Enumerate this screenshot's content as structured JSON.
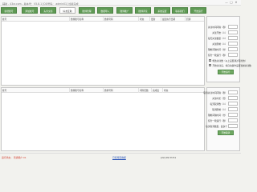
{
  "window": {
    "title": "辅助 - 43xr.com - 版本号：V5.8.1    [QQ号码：  admin01]  加载完成",
    "controls": [
      "—",
      "□",
      "✕"
    ]
  },
  "tabs": [
    {
      "label": "新增账号",
      "active": false
    },
    {
      "label": "添加帐号",
      "active": false
    },
    {
      "label": "头条交易",
      "active": false
    },
    {
      "label": "好友互助",
      "active": true
    },
    {
      "label": "微博管理",
      "active": false
    },
    {
      "label": "数据导入",
      "active": false
    },
    {
      "label": "微博推广",
      "active": false
    },
    {
      "label": "微博评论",
      "active": false
    },
    {
      "label": "系统设置",
      "active": false
    },
    {
      "label": "联系我们",
      "active": false
    },
    {
      "label": "开始运行",
      "active": false
    }
  ],
  "top_table": {
    "columns": [
      "账号",
      "微博账号名称",
      "微博号码",
      "状态",
      "更新",
      "最近执行日期",
      "回调"
    ]
  },
  "bottom_table": {
    "columns": [
      "账号",
      "微博账号名称",
      "微博号码",
      "间隔天数",
      "完成度",
      "状态"
    ]
  },
  "top_settings": {
    "fields": [
      {
        "label": "关注时间间隔（秒）"
      },
      {
        "label": "关注开始（人）"
      },
      {
        "label": "每天关注数量（人）"
      },
      {
        "label": "关注限制（人）"
      },
      {
        "label": "限制间隔时间（分）"
      },
      {
        "label": "任务一轮运行（秒）"
      }
    ],
    "checkboxes": [
      {
        "label": "修改关注数（以上设置通过可用的）"
      },
      {
        "label": "开始关注后，将自动操作设置当前关注数"
      }
    ],
    "button": "开始运行"
  },
  "bottom_settings": {
    "fields": [
      {
        "label": "取消关注时间间隔（秒）"
      },
      {
        "label": "关注时长（天）"
      },
      {
        "label": "每天取消数（人）"
      },
      {
        "label": "取消限制（人）"
      },
      {
        "label": "限制间隔时间（分）"
      },
      {
        "label": "任务一轮运行（秒）"
      },
      {
        "label": "每次取消数量，最多十"
      }
    ],
    "button": "开始取消"
  },
  "statusbar": {
    "left": "运行状态：  普通用户 01",
    "middle": "已经用完数据",
    "right": "[22]    09:33:51"
  },
  "colors": {
    "tab_green": "#5f9a54",
    "button_green": "#6fa862",
    "status_red": "#d23b2b",
    "status_blue": "#2b55b8"
  }
}
